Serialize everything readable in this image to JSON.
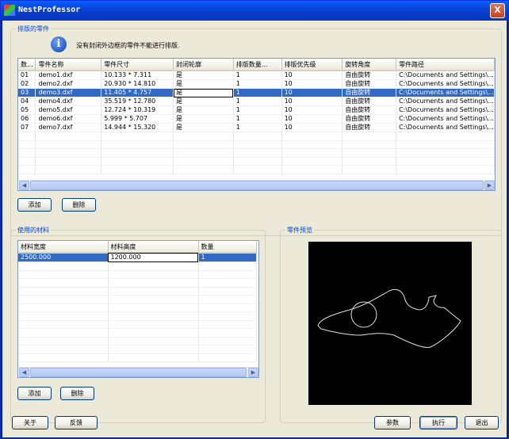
{
  "window": {
    "title": "NestProfessor",
    "close_label": "X"
  },
  "parts_group": {
    "legend": "排版的零件",
    "info_icon": "i",
    "message": "没有封闭外边框的零件不能进行排版.",
    "columns": [
      "数...",
      "零件名称",
      "零件尺寸",
      "封闭轮廓",
      "排版数量...",
      "排版优先级",
      "旋转角度",
      "零件路径"
    ],
    "rows": [
      [
        "01",
        "demo1.dxf",
        "10.133 * 7.311",
        "是",
        "1",
        "10",
        "自由旋转",
        "C:\\Documents and Settings\\..."
      ],
      [
        "02",
        "demo2.dxf",
        "20.930 * 14.810",
        "是",
        "1",
        "10",
        "自由旋转",
        "C:\\Documents and Settings\\..."
      ],
      [
        "03",
        "demo3.dxf",
        "11.405 * 4.757",
        "是",
        "1",
        "10",
        "自由旋转",
        "C:\\Documents and Settings\\..."
      ],
      [
        "04",
        "demo4.dxf",
        "35.519 * 12.780",
        "是",
        "1",
        "10",
        "自由旋转",
        "C:\\Documents and Settings\\..."
      ],
      [
        "05",
        "demo5.dxf",
        "12.724 * 10.319",
        "是",
        "1",
        "10",
        "自由旋转",
        "C:\\Documents and Settings\\..."
      ],
      [
        "06",
        "demo6.dxf",
        "5.999 * 5.707",
        "是",
        "1",
        "10",
        "自由旋转",
        "C:\\Documents and Settings\\..."
      ],
      [
        "07",
        "demo7.dxf",
        "14.944 * 15.320",
        "是",
        "1",
        "10",
        "自由旋转",
        "C:\\Documents and Settings\\..."
      ]
    ],
    "selected_row": 2,
    "add_label": "添加",
    "delete_label": "删除"
  },
  "material_group": {
    "legend": "使用的材料",
    "columns": [
      "材料宽度",
      "材料高度",
      "数量"
    ],
    "rows": [
      [
        "2500.000",
        "1200.000",
        "1"
      ]
    ],
    "add_label": "添加",
    "delete_label": "删除"
  },
  "preview_group": {
    "legend": "零件预览"
  },
  "footer": {
    "about_label": "关于",
    "feedback_label": "反馈",
    "params_label": "参数",
    "run_label": "执行",
    "exit_label": "退出"
  },
  "colors": {
    "selection": "#316ac5",
    "title_bar": "#0842d8",
    "legend_text": "#0046d5"
  }
}
